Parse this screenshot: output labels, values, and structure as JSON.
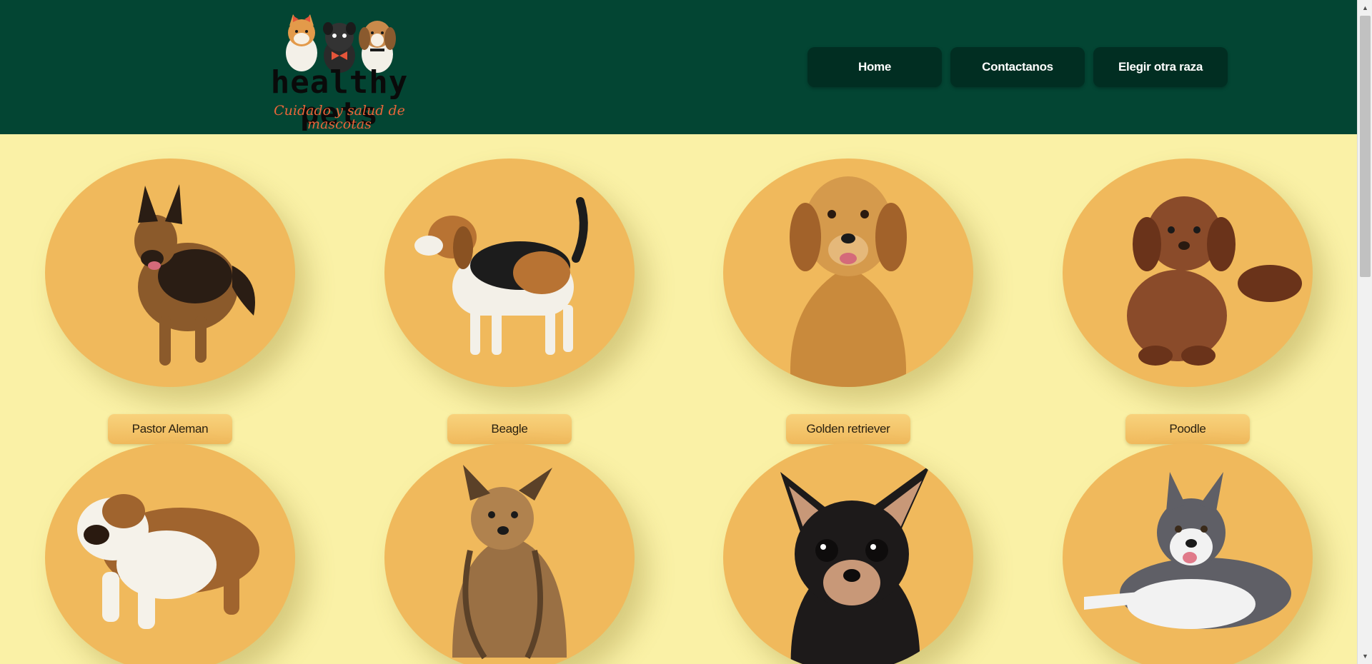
{
  "brand": {
    "name": "healthy pets",
    "tagline": "Cuidado y salud de mascotas"
  },
  "nav": [
    {
      "label": "Home"
    },
    {
      "label": "Contactanos"
    },
    {
      "label": "Elegir otra raza"
    }
  ],
  "breeds": [
    {
      "label": "Pastor Aleman",
      "icon": "german-shepherd-icon",
      "fur": "#8b5a2b",
      "accent": "#2a1d14"
    },
    {
      "label": "Beagle",
      "icon": "beagle-icon",
      "fur": "#b87333",
      "accent": "#1c1c1c"
    },
    {
      "label": "Golden retriever",
      "icon": "golden-retriever-icon",
      "fur": "#c98a3c",
      "accent": "#a2622a"
    },
    {
      "label": "Poodle",
      "icon": "poodle-icon",
      "fur": "#8a4b2a",
      "accent": "#6a331a"
    },
    {
      "label": "",
      "icon": "bulldog-icon",
      "fur": "#a0642e",
      "accent": "#f5f2ea"
    },
    {
      "label": "",
      "icon": "yorkshire-icon",
      "fur": "#9a7044",
      "accent": "#5b4128"
    },
    {
      "label": "",
      "icon": "chihuahua-icon",
      "fur": "#1d1a1a",
      "accent": "#c89878"
    },
    {
      "label": "",
      "icon": "husky-icon",
      "fur": "#5f5f66",
      "accent": "#f2f2f2"
    }
  ],
  "colors": {
    "header": "#034533",
    "nav_button": "#012e22",
    "background": "#faf1a6",
    "circle": "#f0b95c",
    "tagline": "#e8663a"
  }
}
